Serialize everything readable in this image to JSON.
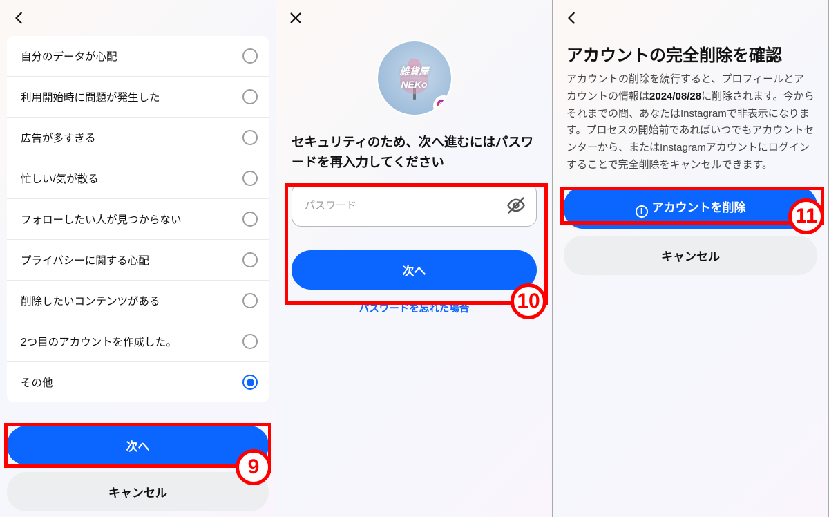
{
  "ui": {
    "next": "次へ",
    "cancel": "キャンセル"
  },
  "panel1": {
    "reasons": [
      "自分のデータが心配",
      "利用開始時に問題が発生した",
      "広告が多すぎる",
      "忙しい/気が散る",
      "フォローしたい人が見つからない",
      "プライバシーに関する心配",
      "削除したいコンテンツがある",
      "2つ目のアカウントを作成した。",
      "その他"
    ],
    "selected_index": 8,
    "step_badge": "9"
  },
  "panel2": {
    "avatar_text_line1": "雑貨屋",
    "avatar_text_line2": "NEKo",
    "heading": "セキュリティのため、次へ進むにはパスワードを再入力してください",
    "placeholder": "パスワード",
    "forgot": "パスワードを忘れた場合",
    "step_badge": "10"
  },
  "panel3": {
    "title": "アカウントの完全削除を確認",
    "body_prefix": "アカウントの削除を続行すると、プロフィールとアカウントの情報は",
    "date": "2024/08/28",
    "body_suffix": "に削除されます。今からそれまでの間、あなたはInstagramで非表示になります。プロセスの開始前であればいつでもアカウントセンターから、またはInstagramアカウントにログインすることで完全削除をキャンセルできます。",
    "delete_label": "アカウントを削除",
    "step_badge": "11"
  }
}
